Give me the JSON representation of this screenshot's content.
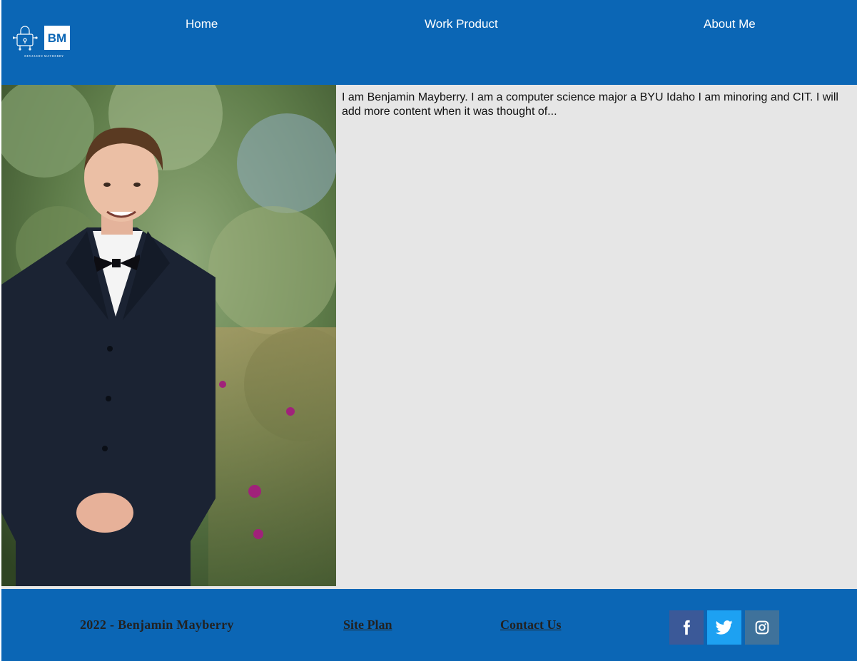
{
  "header": {
    "logo": {
      "monogram": "BM",
      "caption": "BENJAMIN MAYBERRY",
      "icon": "robot-lock-icon"
    },
    "nav": [
      {
        "label": "Home"
      },
      {
        "label": "Work Product"
      },
      {
        "label": "About Me"
      }
    ]
  },
  "main": {
    "photo_icon": "portrait-photo",
    "about_text": "I am Benjamin Mayberry. I am a computer science major a BYU Idaho I am minoring and CIT. I will add more content when it was thought of..."
  },
  "footer": {
    "copyright": "2022 - Benjamin Mayberry",
    "links": [
      {
        "label": "Site Plan"
      },
      {
        "label": "Contact Us"
      }
    ],
    "social": [
      {
        "name": "facebook",
        "icon": "facebook-icon",
        "color": "#3b5998"
      },
      {
        "name": "twitter",
        "icon": "twitter-icon",
        "color": "#1da1f2"
      },
      {
        "name": "instagram",
        "icon": "instagram-icon",
        "color": "#3f729b"
      }
    ]
  },
  "colors": {
    "brand_blue": "#0b66b5",
    "content_bg": "#e6e6e6",
    "footer_text": "#222222"
  }
}
